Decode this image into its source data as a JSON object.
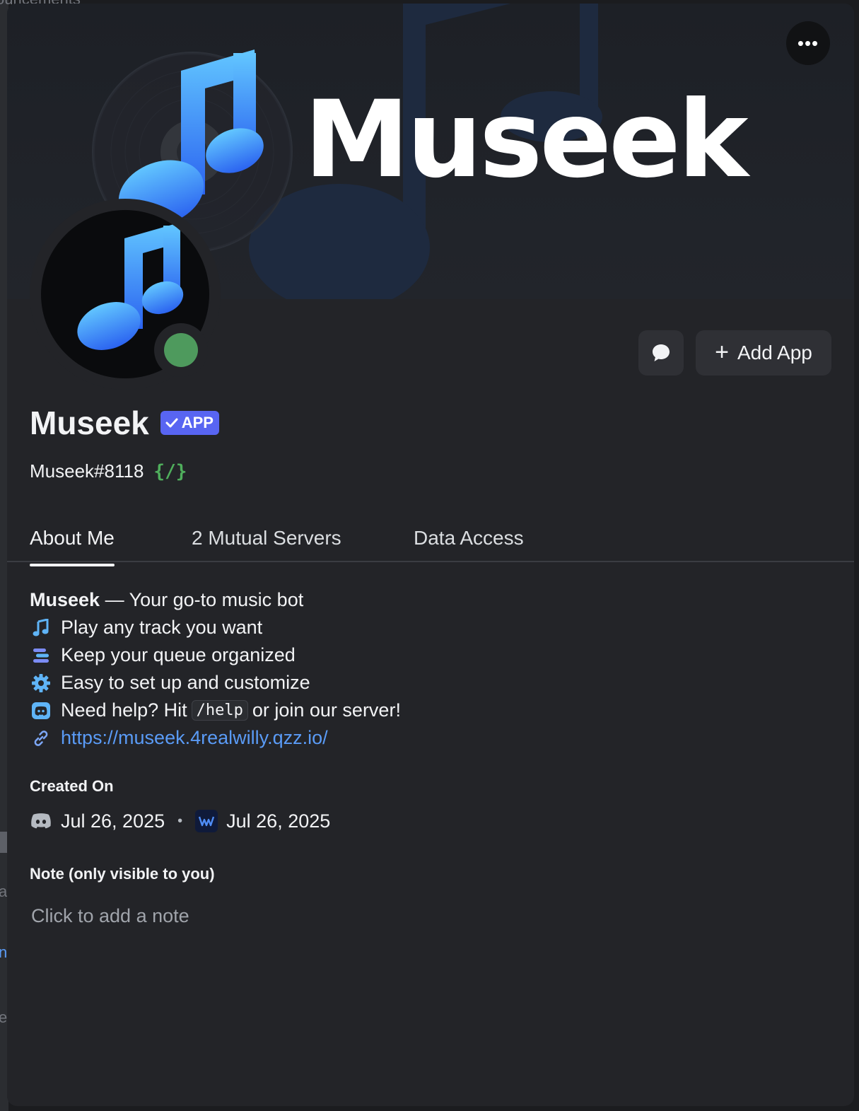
{
  "background": {
    "heading_fragment": "ouncements",
    "letters": [
      "a",
      "n",
      "e"
    ]
  },
  "banner": {
    "title": "Museek",
    "more_label": "•••"
  },
  "header": {
    "message_icon": "chat-bubble-icon",
    "add_app_label": "Add App",
    "display_name": "Museek",
    "badge_label": "APP",
    "username": "Museek#8118",
    "slash_badge": "{/}",
    "status": "online",
    "status_color": "#4e9a5d"
  },
  "tabs": [
    {
      "label": "About Me",
      "active": true
    },
    {
      "label": "2 Mutual Servers",
      "active": false
    },
    {
      "label": "Data Access",
      "active": false
    }
  ],
  "about": {
    "name": "Museek",
    "tagline": " — Your go-to music bot",
    "lines": [
      {
        "icon": "music-note-icon",
        "text": "Play any track you want"
      },
      {
        "icon": "queue-list-icon",
        "text": "Keep your queue organized"
      },
      {
        "icon": "gear-icon",
        "text": "Easy to set up and customize"
      },
      {
        "icon": "discord-icon",
        "text_before": "Need help? Hit",
        "code": "/help",
        "text_after": "or join our server!"
      },
      {
        "icon": "link-icon",
        "link": "https://museek.4realwilly.qzz.io/"
      }
    ]
  },
  "created": {
    "label": "Created On",
    "discord_date": "Jul 26, 2025",
    "separator": "•",
    "server_date": "Jul 26, 2025"
  },
  "note": {
    "label": "Note (only visible to you)",
    "placeholder": "Click to add a note"
  },
  "colors": {
    "accent": "#5865f2",
    "link": "#5a9bf6",
    "online": "#4e9a5d",
    "music_blue": "#3d8cf5"
  }
}
